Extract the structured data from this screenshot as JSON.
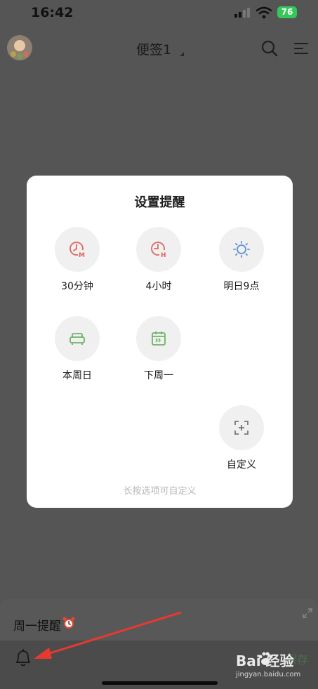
{
  "status_bar": {
    "time": "16:42",
    "battery": "76"
  },
  "header": {
    "title": "便签1",
    "avatar_icon": "avatar-icon",
    "search_icon": "search-icon",
    "menu_icon": "menu-icon"
  },
  "dialog": {
    "title": "设置提醒",
    "options": [
      {
        "label": "30分钟",
        "icon": "clock-m-icon",
        "color": "#e0675f"
      },
      {
        "label": "4小时",
        "icon": "clock-h-icon",
        "color": "#e0675f"
      },
      {
        "label": "明日9点",
        "icon": "sun-icon",
        "color": "#5b8fd8"
      },
      {
        "label": "本周日",
        "icon": "sofa-icon",
        "color": "#6fb36a"
      },
      {
        "label": "下周一",
        "icon": "calendar-icon",
        "color": "#6fb36a"
      },
      {
        "label": "自定义",
        "icon": "add-frame-icon",
        "color": "#777777"
      }
    ],
    "hint": "长按选项可自定义"
  },
  "bottom": {
    "reminder_text": "周一提醒",
    "save_label": "保存"
  },
  "watermark": {
    "logo": "Bai  经验",
    "sub": "jingyan.baidu.com"
  },
  "colors": {
    "overlay": "#555555",
    "accent_red": "#e0675f",
    "accent_blue": "#5b8fd8",
    "accent_green": "#6fb36a",
    "arrow": "#e8392f"
  }
}
